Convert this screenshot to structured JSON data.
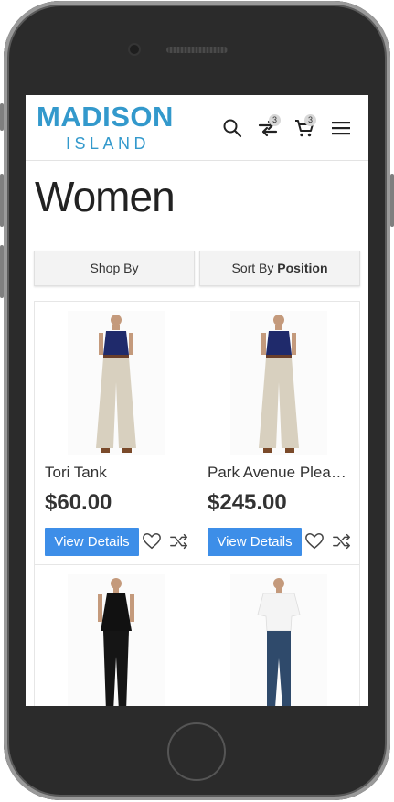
{
  "header": {
    "logo_top": "MADISON",
    "logo_bottom": "ISLAND",
    "compare_count": "3",
    "cart_count": "3",
    "icons": [
      "search-icon",
      "compare-icon",
      "cart-icon",
      "menu-icon"
    ]
  },
  "page": {
    "title": "Women"
  },
  "filters": {
    "shop_by": "Shop By",
    "sort_prefix": "Sort By",
    "sort_value": "Position"
  },
  "products": [
    {
      "name": "Tori Tank",
      "price": "$60.00",
      "button": "View Details"
    },
    {
      "name": "Park Avenue Pleat Front Trousers",
      "price": "$245.00",
      "button": "View Details"
    },
    {
      "name": "",
      "price": "",
      "button": ""
    },
    {
      "name": "",
      "price": "",
      "button": ""
    }
  ],
  "colors": {
    "brand": "#3399cc",
    "button": "#3d8ee8",
    "top_navy": "#1f2a6b",
    "pants_khaki": "#d8d0bf"
  }
}
